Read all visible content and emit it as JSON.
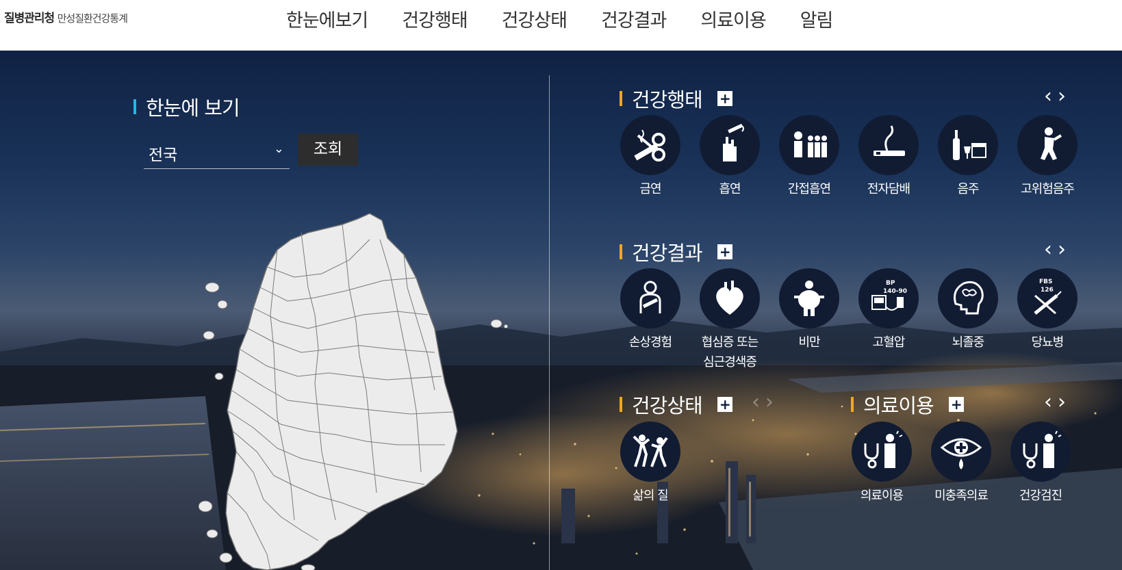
{
  "header": {
    "logo_main": "질병관리청",
    "logo_sub": "만성질환건강통계",
    "nav": [
      "한눈에보기",
      "건강행태",
      "건강상태",
      "건강결과",
      "의료이용",
      "알림"
    ]
  },
  "overview": {
    "title": "한눈에 보기",
    "region_value": "전국",
    "search_label": "조회"
  },
  "health_behavior": {
    "title": "건강행태",
    "items": [
      "금연",
      "흡연",
      "간접흡연",
      "전자담배",
      "음주",
      "고위험음주"
    ]
  },
  "health_outcome": {
    "title": "건강결과",
    "items": [
      "손상경험",
      "협심증 또는",
      "비만",
      "고혈압",
      "뇌졸중",
      "당뇨병"
    ],
    "item2_line2": "심근경색증",
    "bp_text": "BP",
    "bp_value": "140-90",
    "fbs_text": "FBS",
    "fbs_value": "126"
  },
  "health_status": {
    "title": "건강상태",
    "items": [
      "삶의 질"
    ]
  },
  "medical_use": {
    "title": "의료이용",
    "items": [
      "의료이용",
      "미충족의료",
      "건강검진"
    ]
  },
  "colors": {
    "accent_cyan": "#22b6e6",
    "accent_gold": "#f0a820",
    "icon_bg": "#111c33"
  },
  "icons": {
    "arrow_prev": "‹",
    "arrow_next": "›",
    "plus": "+",
    "chevron": "⌄"
  }
}
